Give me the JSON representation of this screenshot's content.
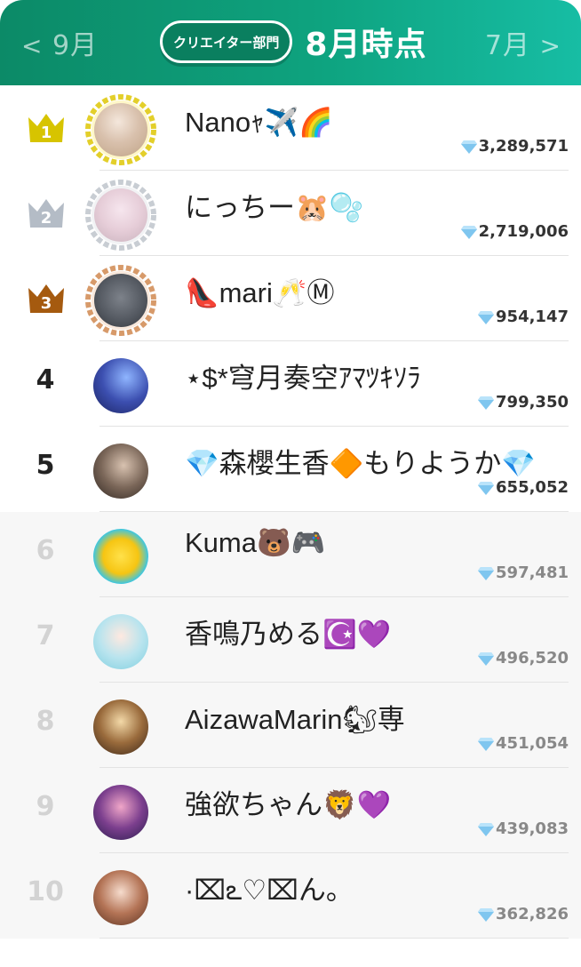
{
  "header": {
    "prev_label": "9月",
    "next_label": "7月",
    "prev_arrow": "<",
    "next_arrow": ">",
    "category": "クリエイター部門",
    "period": "8月時点"
  },
  "colors": {
    "header_start": "#0c8a67",
    "header_end": "#17bda4",
    "gold": "#d7c400",
    "silver": "#b4bcc6",
    "bronze": "#a55a0f",
    "gem": "#7fc6ef"
  },
  "rows": [
    {
      "rank": "1",
      "name": "Nanoｬ✈️🌈",
      "score": "3,289,571",
      "medal": "gold"
    },
    {
      "rank": "2",
      "name": "にっちー🐹🫧",
      "score": "2,719,006",
      "medal": "silver"
    },
    {
      "rank": "3",
      "name": "👠mari🥂Ⓜ",
      "score": "954,147",
      "medal": "bronze"
    },
    {
      "rank": "4",
      "name": "⋆$*穹月奏空ｱﾏﾂｷｿﾗ",
      "score": "799,350"
    },
    {
      "rank": "5",
      "name": "💎森櫻生香🔶もりようか💎",
      "score": "655,052"
    },
    {
      "rank": "6",
      "name": "Kuma🐻🎮",
      "score": "597,481"
    },
    {
      "rank": "7",
      "name": "香鳴乃める☪️💜",
      "score": "496,520"
    },
    {
      "rank": "8",
      "name": "AizawaMarin🐿専",
      "score": "451,054"
    },
    {
      "rank": "9",
      "name": "強欲ちゃん🦁💜",
      "score": "439,083"
    },
    {
      "rank": "10",
      "name": "·⌧ఽ♡⌧ん。",
      "score": "362,826"
    }
  ]
}
